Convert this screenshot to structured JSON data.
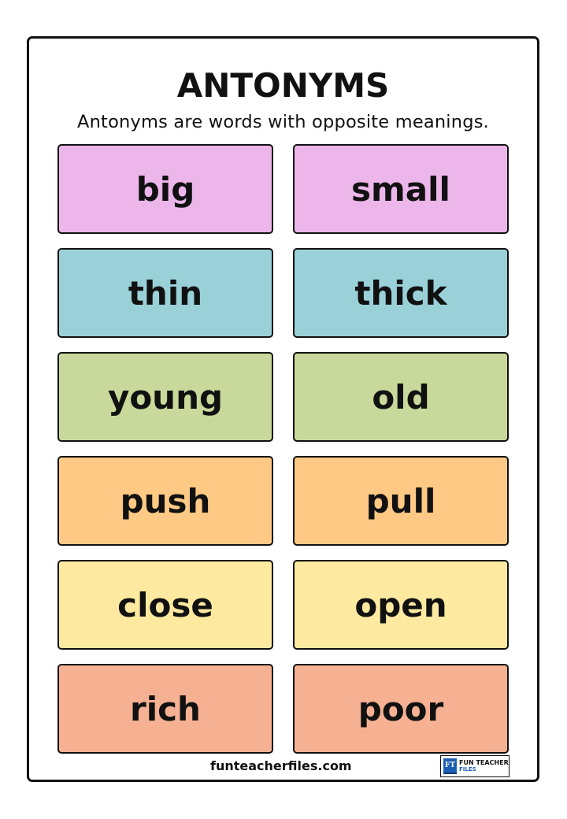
{
  "header": {
    "title": "ANTONYMS",
    "subtitle": "Antonyms are words with opposite meanings."
  },
  "pairs": [
    {
      "left": "big",
      "right": "small",
      "color": "#ecb6eb"
    },
    {
      "left": "thin",
      "right": "thick",
      "color": "#9ad1d8"
    },
    {
      "left": "young",
      "right": "old",
      "color": "#c9d99b"
    },
    {
      "left": "push",
      "right": "pull",
      "color": "#fdc984"
    },
    {
      "left": "close",
      "right": "open",
      "color": "#fde9a0"
    },
    {
      "left": "rich",
      "right": "poor",
      "color": "#f6b193"
    }
  ],
  "footer": {
    "website": "funteacherfiles.com",
    "logo_mark": "FT",
    "logo_line1": "FUN TEACHER",
    "logo_line2": "FILES"
  }
}
